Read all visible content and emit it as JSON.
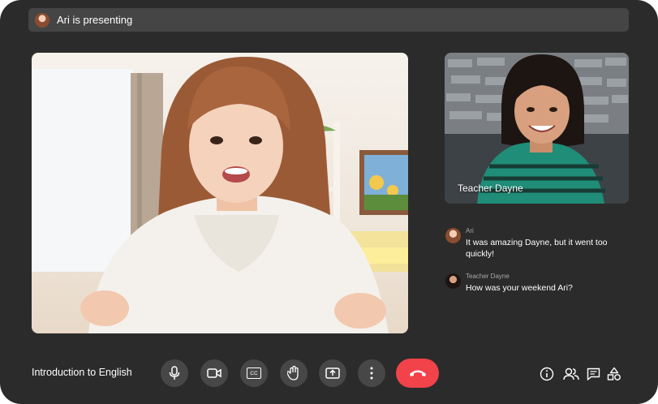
{
  "presenting": {
    "label": "Ari is presenting"
  },
  "main_video": {
    "participant": "Ari"
  },
  "side_video": {
    "name": "Teacher Dayne"
  },
  "chat": {
    "messages": [
      {
        "sender": "Ari",
        "text": "It was amazing Dayne, but it went too quickly!"
      },
      {
        "sender": "Teacher Dayne",
        "text": "How was your weekend Ari?"
      }
    ]
  },
  "meeting": {
    "title": "Introduction to English"
  },
  "controls": [
    {
      "icon": "microphone-icon"
    },
    {
      "icon": "camera-icon"
    },
    {
      "icon": "captions-icon",
      "text": "CC"
    },
    {
      "icon": "raise-hand-icon"
    },
    {
      "icon": "present-screen-icon"
    },
    {
      "icon": "more-options-icon"
    },
    {
      "icon": "end-call-icon"
    }
  ],
  "right_icons": [
    "info-icon",
    "people-icon",
    "chat-icon",
    "activities-icon"
  ],
  "colors": {
    "background": "#2b2b2b",
    "control": "#474747",
    "end_call": "#f2424a",
    "text": "#ffffff",
    "muted_text": "#a9a9a9"
  }
}
